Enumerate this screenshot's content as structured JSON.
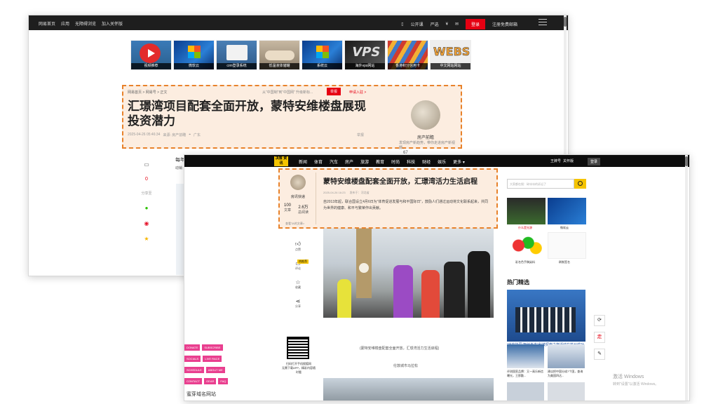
{
  "back_window": {
    "topnav_left": [
      "网易首页",
      "应用",
      "无障碍浏览",
      "加入关怀版"
    ],
    "topnav_right": [
      "公开课",
      "严选",
      "",
      "登录",
      "注册免费邮箱"
    ],
    "ads": [
      "视频推荐",
      "微软云",
      "crm登录系统",
      "低温液体储罐",
      "系统云",
      "海外vps网站",
      "香港积分信用卡",
      "中文网站网站"
    ],
    "breadcrumb": "网易首页 > 网易号 > 正文",
    "subtitle": "从“中国制”到“中国网” 升级新标...",
    "report": "举报",
    "submit": "申请入驻 >",
    "title": "汇璟湾项目配套全面开放，蒙特安维楼盘展现投资潜力",
    "date": "2025-04-26 05:46:34",
    "source": "来源: 房产前瞻",
    "location": "广东",
    "report_link": "举报",
    "author_name": "房产前瞻",
    "author_desc": "发现房产新趋势，带你走进房产新视野。",
    "comment_count": "0",
    "share_label": "分享至",
    "body_snippet": "每年",
    "body_snippet2": "动销",
    "side_number": "67"
  },
  "front_window": {
    "logo": "决策 资讯",
    "nav": [
      "新闻",
      "体育",
      "汽车",
      "房产",
      "旅游",
      "教育",
      "时尚",
      "科技",
      "财经",
      "娱乐",
      "更多 ▾"
    ],
    "subscribe": [
      "王牌号",
      "关怀版"
    ],
    "login": "登录",
    "author_name": "房讯快递",
    "stats": [
      {
        "value": "100",
        "label": "文章"
      },
      {
        "value": "2.6万",
        "label": "总阅读"
      }
    ],
    "follow": "查看TA的文章>",
    "title": "蒙特安维楼盘配套全面开放，汇璟湾活力生活启程",
    "date": "2025-04-26 16:23",
    "source": "发布于：河北省",
    "body": "自2013年起，联合国设立4月6日为“体育促进发展与和平国际日”，鼓励人们通过运动将文化联系起来，共同为世界的健康、和平与繁荣作出贡献。",
    "search_placeholder": "大家都在搜：碎冰冰的诉讼了",
    "thumb_labels": [
      "什么是光源",
      "微软云",
      "彩名色手稿染料",
      "刷制签名"
    ],
    "left_rail": [
      "点赞",
      "评论",
      "收藏",
      "分享"
    ],
    "badge": "热推荐",
    "hot_title": "热门精选",
    "hot_caption": "\"京杭协同 智创未来\"科技探索之旅活动在杭州成功举办",
    "minis": [
      "评测国家品牌：又一高乐新信曝光，王那勤...",
      "建议把中国分成7个国，查询为美国四达..."
    ],
    "caption": "(蒙特安维楼盘配套全面开放，汇璟湾活力生活启程)",
    "source_city": "伦敦城市马拉松",
    "qr_title": "扫码打开手机搜狐网",
    "qr_sub": "无需下载APP，精彩内容随时看",
    "pink_buttons": [
      "DONATE",
      "SUBSCRIBE",
      "SOCIALS",
      "LIVE RACE",
      "SCHEDULE",
      "ABOUT ME",
      "CONTACT",
      "GEAR",
      "FAQ"
    ],
    "domain_text": "蜜芽域名网站"
  },
  "activation": {
    "line1": "激活 Windows",
    "line2": "转到\"设置\"以激活 Windows。"
  }
}
